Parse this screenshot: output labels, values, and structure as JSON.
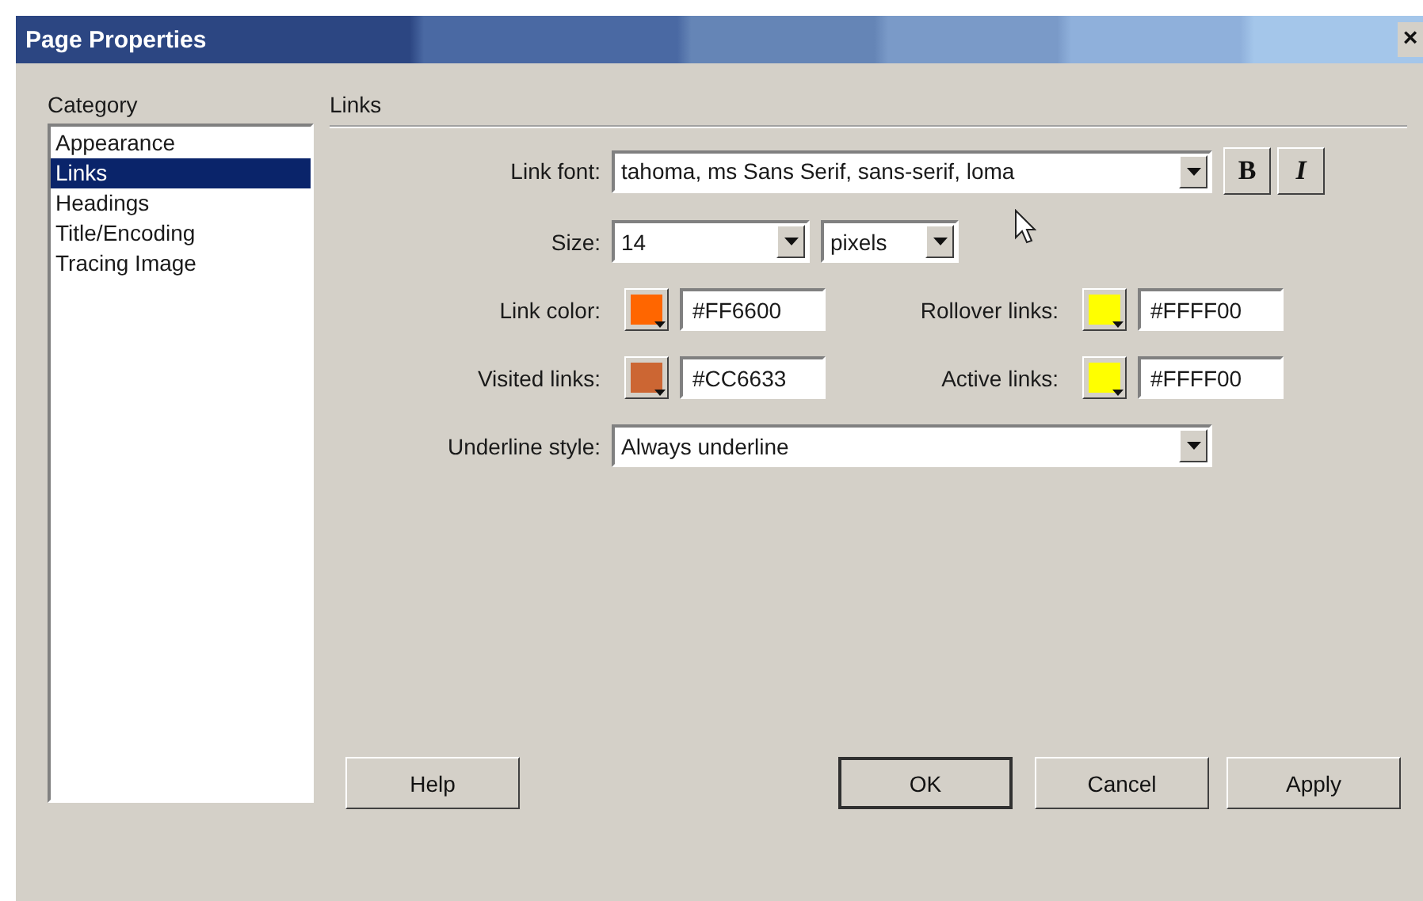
{
  "window": {
    "title": "Page Properties",
    "close": "×"
  },
  "category": {
    "label": "Category",
    "items": [
      {
        "label": "Appearance",
        "selected": false
      },
      {
        "label": "Links",
        "selected": true
      },
      {
        "label": "Headings",
        "selected": false
      },
      {
        "label": "Title/Encoding",
        "selected": false
      },
      {
        "label": "Tracing Image",
        "selected": false
      }
    ]
  },
  "section": {
    "title": "Links"
  },
  "link_font": {
    "label": "Link font:",
    "value": "tahoma, ms Sans Serif, sans-serif, loma",
    "bold_button": "B",
    "italic_button": "I"
  },
  "size": {
    "label": "Size:",
    "value": "14",
    "unit": "pixels"
  },
  "colors": [
    {
      "label": "Link color:",
      "color": "#ff6600",
      "value": "#FF6600"
    },
    {
      "label": "Rollover links:",
      "color": "#ffff00",
      "value": "#FFFF00"
    },
    {
      "label": "Visited links:",
      "color": "#cc6633",
      "value": "#CC6633"
    },
    {
      "label": "Active links:",
      "color": "#ffff00",
      "value": "#FFFF00"
    }
  ],
  "underline": {
    "label": "Underline style:",
    "value": "Always underline"
  },
  "buttons": [
    {
      "label": "Help",
      "default": false
    },
    {
      "label": "OK",
      "default": true
    },
    {
      "label": "Cancel",
      "default": false
    },
    {
      "label": "Apply",
      "default": false
    }
  ]
}
